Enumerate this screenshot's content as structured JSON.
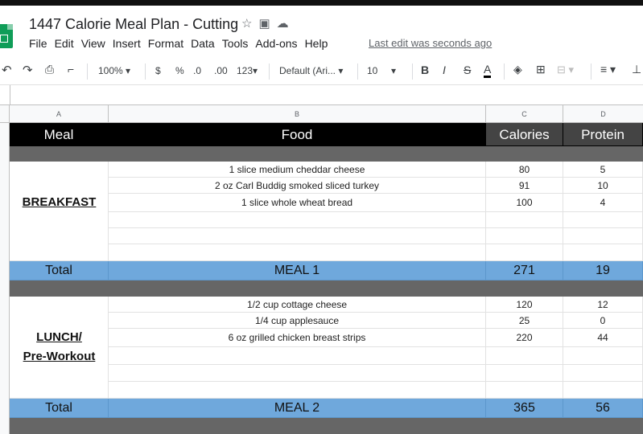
{
  "doc": {
    "title": "1447 Calorie Meal Plan - Cutting",
    "last_edit": "Last edit was seconds ago",
    "menu": [
      "File",
      "Edit",
      "View",
      "Insert",
      "Format",
      "Data",
      "Tools",
      "Add-ons",
      "Help"
    ]
  },
  "toolbar": {
    "zoom": "100%",
    "currency": "$",
    "percent": "%",
    "dec_less": ".0",
    "dec_more": ".00",
    "more_formats": "123",
    "font": "Default (Ari...",
    "font_size": "10",
    "bold": "B",
    "italic": "I",
    "strike": "S",
    "text_color": "A"
  },
  "columns": [
    "A",
    "B",
    "C",
    "D"
  ],
  "header_row": {
    "meal": "Meal",
    "food": "Food",
    "calories": "Calories",
    "protein": "Protein"
  },
  "breakfast": {
    "label": "BREAKFAST",
    "items": [
      {
        "food": "1 slice medium cheddar cheese",
        "calories": "80",
        "protein": "5"
      },
      {
        "food": "2 oz Carl Buddig smoked sliced turkey",
        "calories": "91",
        "protein": "10"
      },
      {
        "food": "1 slice whole wheat bread",
        "calories": "100",
        "protein": "4"
      }
    ],
    "total": {
      "label": "Total",
      "meal": "MEAL 1",
      "calories": "271",
      "protein": "19"
    }
  },
  "lunch": {
    "label_line1": "LUNCH/",
    "label_line2": "Pre-Workout",
    "items": [
      {
        "food": "1/2 cup cottage cheese",
        "calories": "120",
        "protein": "12"
      },
      {
        "food": "1/4 cup applesauce",
        "calories": "25",
        "protein": "0"
      },
      {
        "food": "6 oz grilled chicken breast strips",
        "calories": "220",
        "protein": "44"
      }
    ],
    "total": {
      "label": "Total",
      "meal": "MEAL 2",
      "calories": "365",
      "protein": "56"
    }
  },
  "colors": {
    "header_bg": "#000000",
    "divider_bg": "#666666",
    "total_bg": "#6fa8dc"
  }
}
